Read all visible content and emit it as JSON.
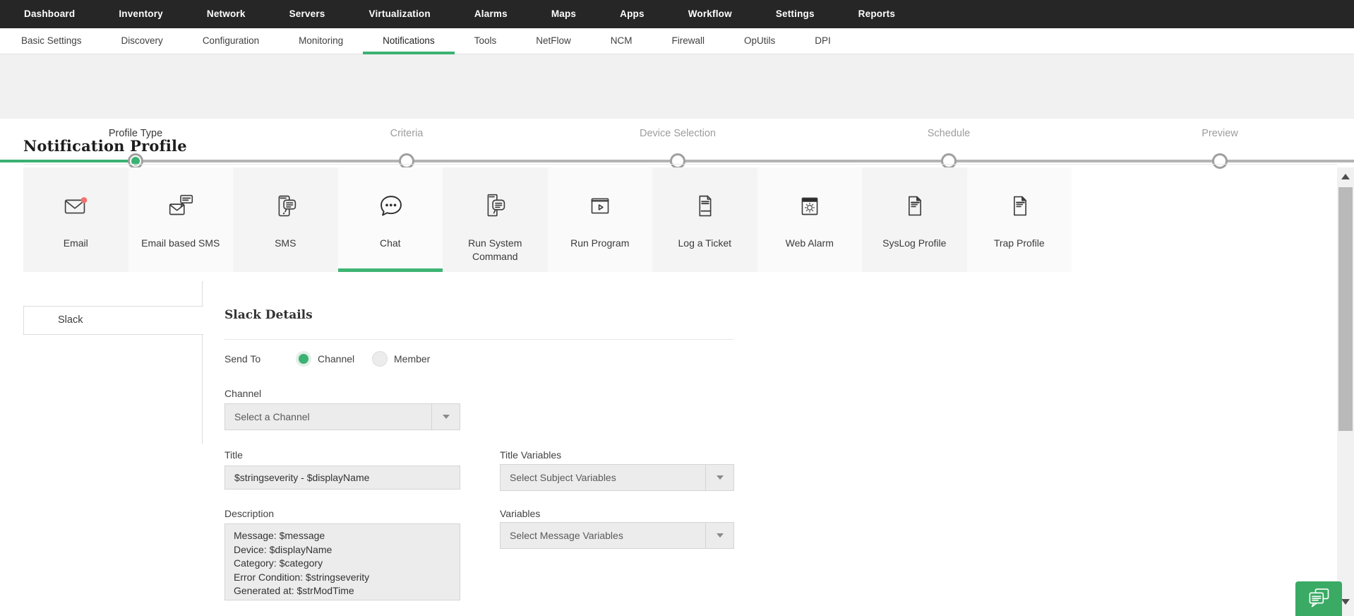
{
  "colors": {
    "accent_green": "#3bb273",
    "top_nav_bg": "#262626",
    "notification_badge_red": "#f3726d",
    "chat_button_green": "#3aaa64"
  },
  "top_nav": {
    "items": [
      "Dashboard",
      "Inventory",
      "Network",
      "Servers",
      "Virtualization",
      "Alarms",
      "Maps",
      "Apps",
      "Workflow",
      "Settings",
      "Reports"
    ]
  },
  "sub_nav": {
    "active": "Notifications",
    "items": [
      "Basic Settings",
      "Discovery",
      "Configuration",
      "Monitoring",
      "Notifications",
      "Tools",
      "NetFlow",
      "NCM",
      "Firewall",
      "OpUtils",
      "DPI"
    ]
  },
  "stepper": {
    "steps": [
      {
        "label": "Profile Type",
        "state": "active"
      },
      {
        "label": "Criteria",
        "state": "upcoming"
      },
      {
        "label": "Device Selection",
        "state": "upcoming"
      },
      {
        "label": "Schedule",
        "state": "upcoming"
      },
      {
        "label": "Preview",
        "state": "upcoming"
      }
    ]
  },
  "page": {
    "title": "Notification Profile"
  },
  "profile_types": {
    "selected": "Chat",
    "items": [
      {
        "label": "Email",
        "icon": "email-icon"
      },
      {
        "label": "Email based SMS",
        "icon": "email-sms-icon"
      },
      {
        "label": "SMS",
        "icon": "sms-icon"
      },
      {
        "label": "Chat",
        "icon": "chat-bubble-icon",
        "selected": true
      },
      {
        "label": "Run System Command",
        "icon": "system-command-icon"
      },
      {
        "label": "Run Program",
        "icon": "run-program-icon"
      },
      {
        "label": "Log a Ticket",
        "icon": "ticket-icon"
      },
      {
        "label": "Web Alarm",
        "icon": "web-alarm-icon"
      },
      {
        "label": "SysLog Profile",
        "icon": "syslog-document-icon"
      },
      {
        "label": "Trap Profile",
        "icon": "trap-document-icon"
      }
    ]
  },
  "sidebar": {
    "items": [
      {
        "label": "Slack",
        "selected": true
      }
    ]
  },
  "form": {
    "heading": "Slack Details",
    "send_to": {
      "label": "Send To",
      "options": [
        "Channel",
        "Member"
      ],
      "selected": "Channel"
    },
    "channel": {
      "label": "Channel",
      "placeholder": "Select a Channel"
    },
    "title": {
      "label": "Title",
      "value": "$stringseverity - $displayName"
    },
    "title_variables": {
      "label": "Title Variables",
      "placeholder": "Select Subject Variables"
    },
    "description": {
      "label": "Description",
      "value": "Message: $message\nDevice: $displayName\nCategory: $category\nError Condition: $stringseverity\nGenerated at: $strModTime"
    },
    "variables": {
      "label": "Variables",
      "placeholder": "Select Message Variables"
    }
  },
  "support_chat": {
    "icon": "chat-bubbles-icon"
  }
}
